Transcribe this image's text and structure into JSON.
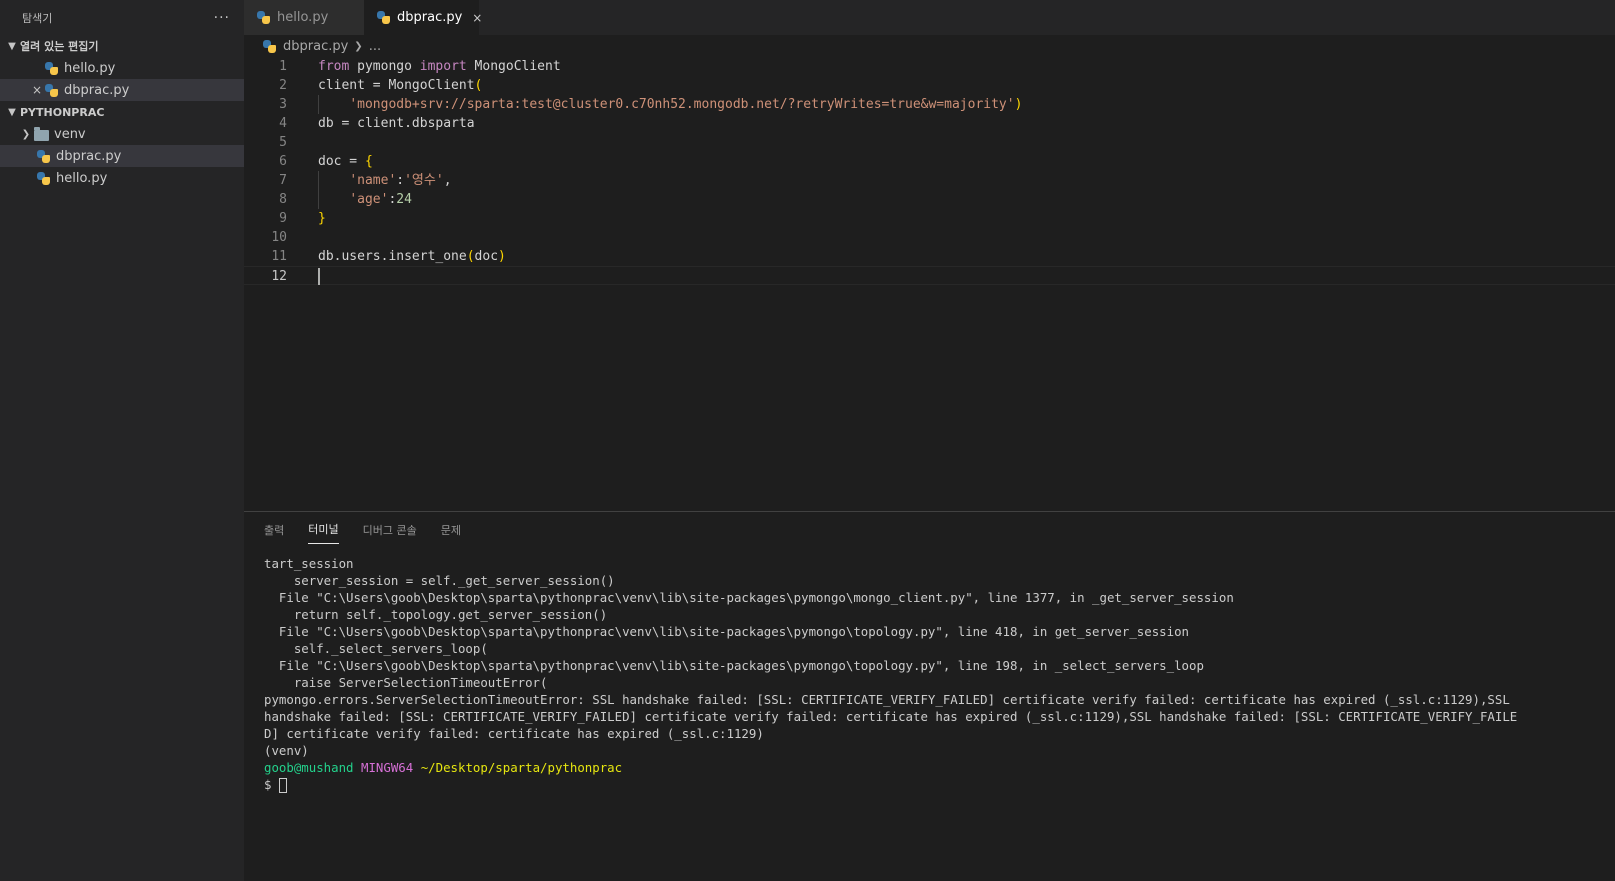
{
  "sidebar": {
    "title": "탐색기",
    "more": "···",
    "open_editors": {
      "label": "열려 있는 편집기",
      "items": [
        {
          "name": "hello.py"
        },
        {
          "name": "dbprac.py",
          "close": "×"
        }
      ]
    },
    "project": {
      "label": "PYTHONPRAC",
      "items": [
        {
          "name": "venv"
        },
        {
          "name": "dbprac.py"
        },
        {
          "name": "hello.py"
        }
      ]
    }
  },
  "tabs": [
    {
      "label": "hello.py",
      "active": false
    },
    {
      "label": "dbprac.py",
      "active": true,
      "close": "×"
    }
  ],
  "breadcrumb": {
    "file": "dbprac.py",
    "rest": "..."
  },
  "editor": {
    "line_numbers": [
      "1",
      "2",
      "3",
      "4",
      "5",
      "6",
      "7",
      "8",
      "9",
      "10",
      "11",
      "12"
    ],
    "current_line": 12
  },
  "panel": {
    "tabs": [
      "출력",
      "터미널",
      "디버그 콘솔",
      "문제"
    ],
    "active_tab": "터미널",
    "terminal": {
      "lines": [
        "tart_session",
        "    server_session = self._get_server_session()",
        "  File \"C:\\Users\\goob\\Desktop\\sparta\\pythonprac\\venv\\lib\\site-packages\\pymongo\\mongo_client.py\", line 1377, in _get_server_session",
        "    return self._topology.get_server_session()",
        "  File \"C:\\Users\\goob\\Desktop\\sparta\\pythonprac\\venv\\lib\\site-packages\\pymongo\\topology.py\", line 418, in get_server_session",
        "    self._select_servers_loop(",
        "  File \"C:\\Users\\goob\\Desktop\\sparta\\pythonprac\\venv\\lib\\site-packages\\pymongo\\topology.py\", line 198, in _select_servers_loop",
        "    raise ServerSelectionTimeoutError(",
        "pymongo.errors.ServerSelectionTimeoutError: SSL handshake failed: [SSL: CERTIFICATE_VERIFY_FAILED] certificate verify failed: certificate has expired (_ssl.c:1129),SSL",
        "handshake failed: [SSL: CERTIFICATE_VERIFY_FAILED] certificate verify failed: certificate has expired (_ssl.c:1129),SSL handshake failed: [SSL: CERTIFICATE_VERIFY_FAILE",
        "D] certificate verify failed: certificate has expired (_ssl.c:1129)",
        "(venv)"
      ],
      "prompt_user": "goob@mushand",
      "prompt_env": "MINGW64",
      "prompt_path": "~/Desktop/sparta/pythonprac",
      "prompt_symbol": "$"
    }
  },
  "colors": {
    "keyword": "#569cd6",
    "string": "#ce9178",
    "number": "#b5cea8",
    "bracket": "#ffd700",
    "terminal_user": "#23d18b",
    "terminal_env": "#d670d6",
    "terminal_path": "#e5e510"
  }
}
